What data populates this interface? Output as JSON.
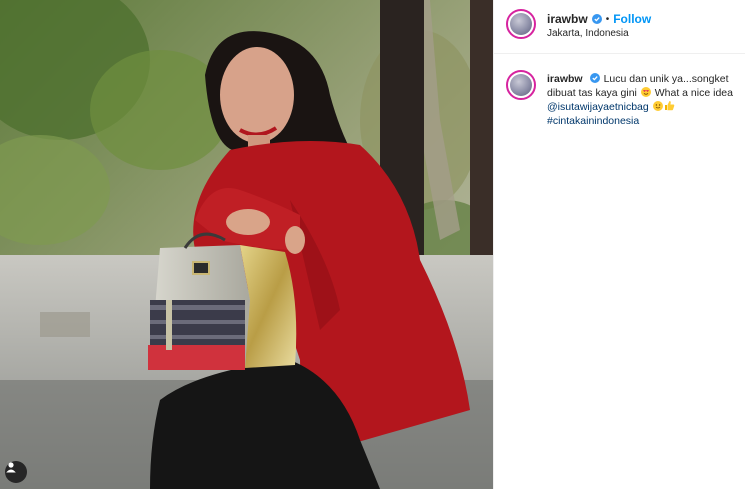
{
  "post": {
    "username": "irawbw",
    "follow_label": "Follow",
    "separator": "•",
    "location": "Jakarta, Indonesia"
  },
  "caption": {
    "username": "irawbw",
    "text_part1": "Lucu dan unik ya...songket dibuat tas kaya gini",
    "text_part2": "What a nice idea",
    "mention": "@isutawijayaetnicbag",
    "hashtag": "#cintakainindonesia"
  },
  "icons": {
    "verified": "verified-badge-icon",
    "tag": "user-tag-icon",
    "emoji1": "heart-eyes-emoji",
    "emoji2": "smiling-face-emoji",
    "emoji3": "thumbs-up-emoji"
  },
  "colors": {
    "link_blue": "#0095f6",
    "mention": "#00376b",
    "story_ring": "#d6249f",
    "dress": "#b3161d"
  }
}
